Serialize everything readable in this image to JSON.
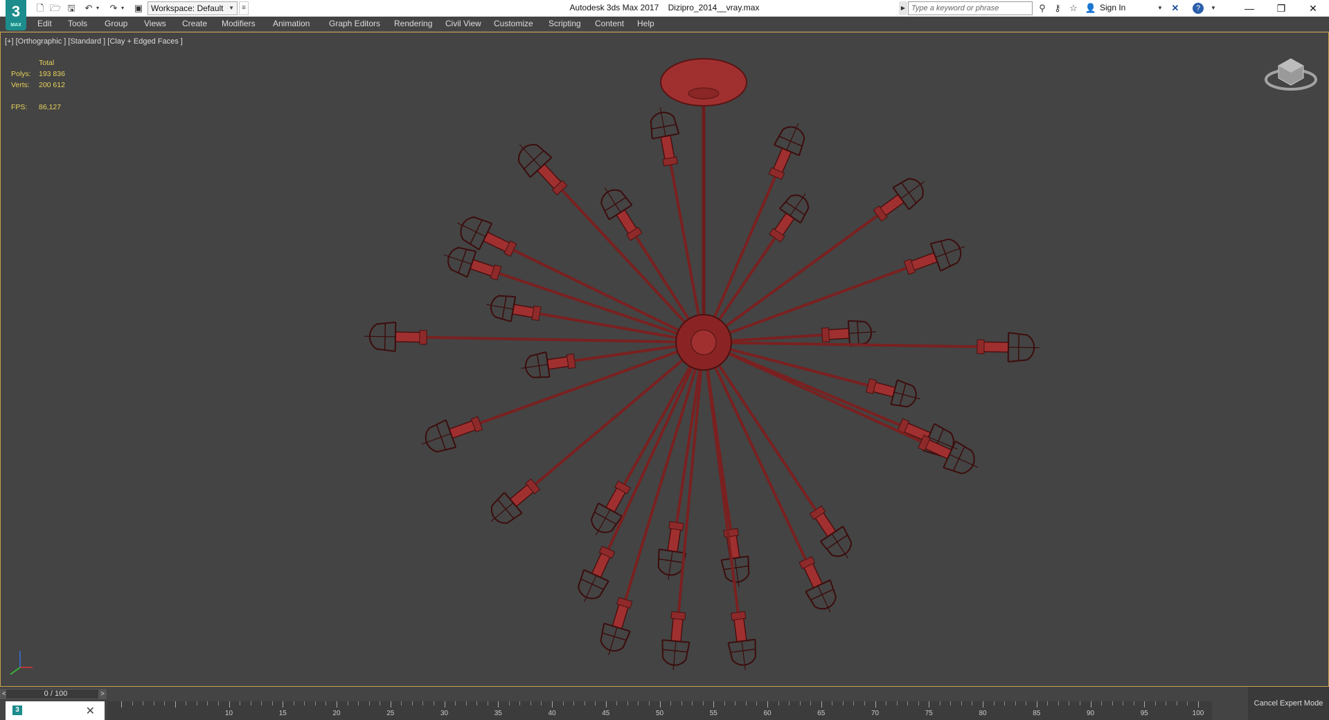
{
  "titlebar": {
    "app_logo_text": "3",
    "app_logo_sub": "MAX",
    "workspace_label": "Workspace: Default",
    "app_name": "Autodesk 3ds Max 2017",
    "file_name": "Dizipro_2014__vray.max",
    "search_placeholder": "Type a keyword or phrase",
    "sign_in_label": "Sign In"
  },
  "menu": [
    "Edit",
    "Tools",
    "Group",
    "Views",
    "Create",
    "Modifiers",
    "Animation",
    "Graph Editors",
    "Rendering",
    "Civil View",
    "Customize",
    "Scripting",
    "Content",
    "Help"
  ],
  "viewport": {
    "label": "[+] [Orthographic ] [Standard ] [Clay + Edged Faces ]",
    "stats": {
      "header": "Total",
      "polys_label": "Polys:",
      "polys_value": "193 836",
      "verts_label": "Verts:",
      "verts_value": "200 612",
      "fps_label": "FPS:",
      "fps_value": "86,127"
    },
    "model_color": "#a03030",
    "frame_color": "#c7a24a"
  },
  "timeline": {
    "slider_label": "0 / 100",
    "prev": "<",
    "next": ">",
    "ticks": [
      "10",
      "15",
      "20",
      "25",
      "30",
      "35",
      "40",
      "45",
      "50",
      "55",
      "60",
      "65",
      "70",
      "75",
      "80",
      "85",
      "90",
      "95",
      "100"
    ],
    "cancel_expert_label": "Cancel Expert Mode"
  }
}
